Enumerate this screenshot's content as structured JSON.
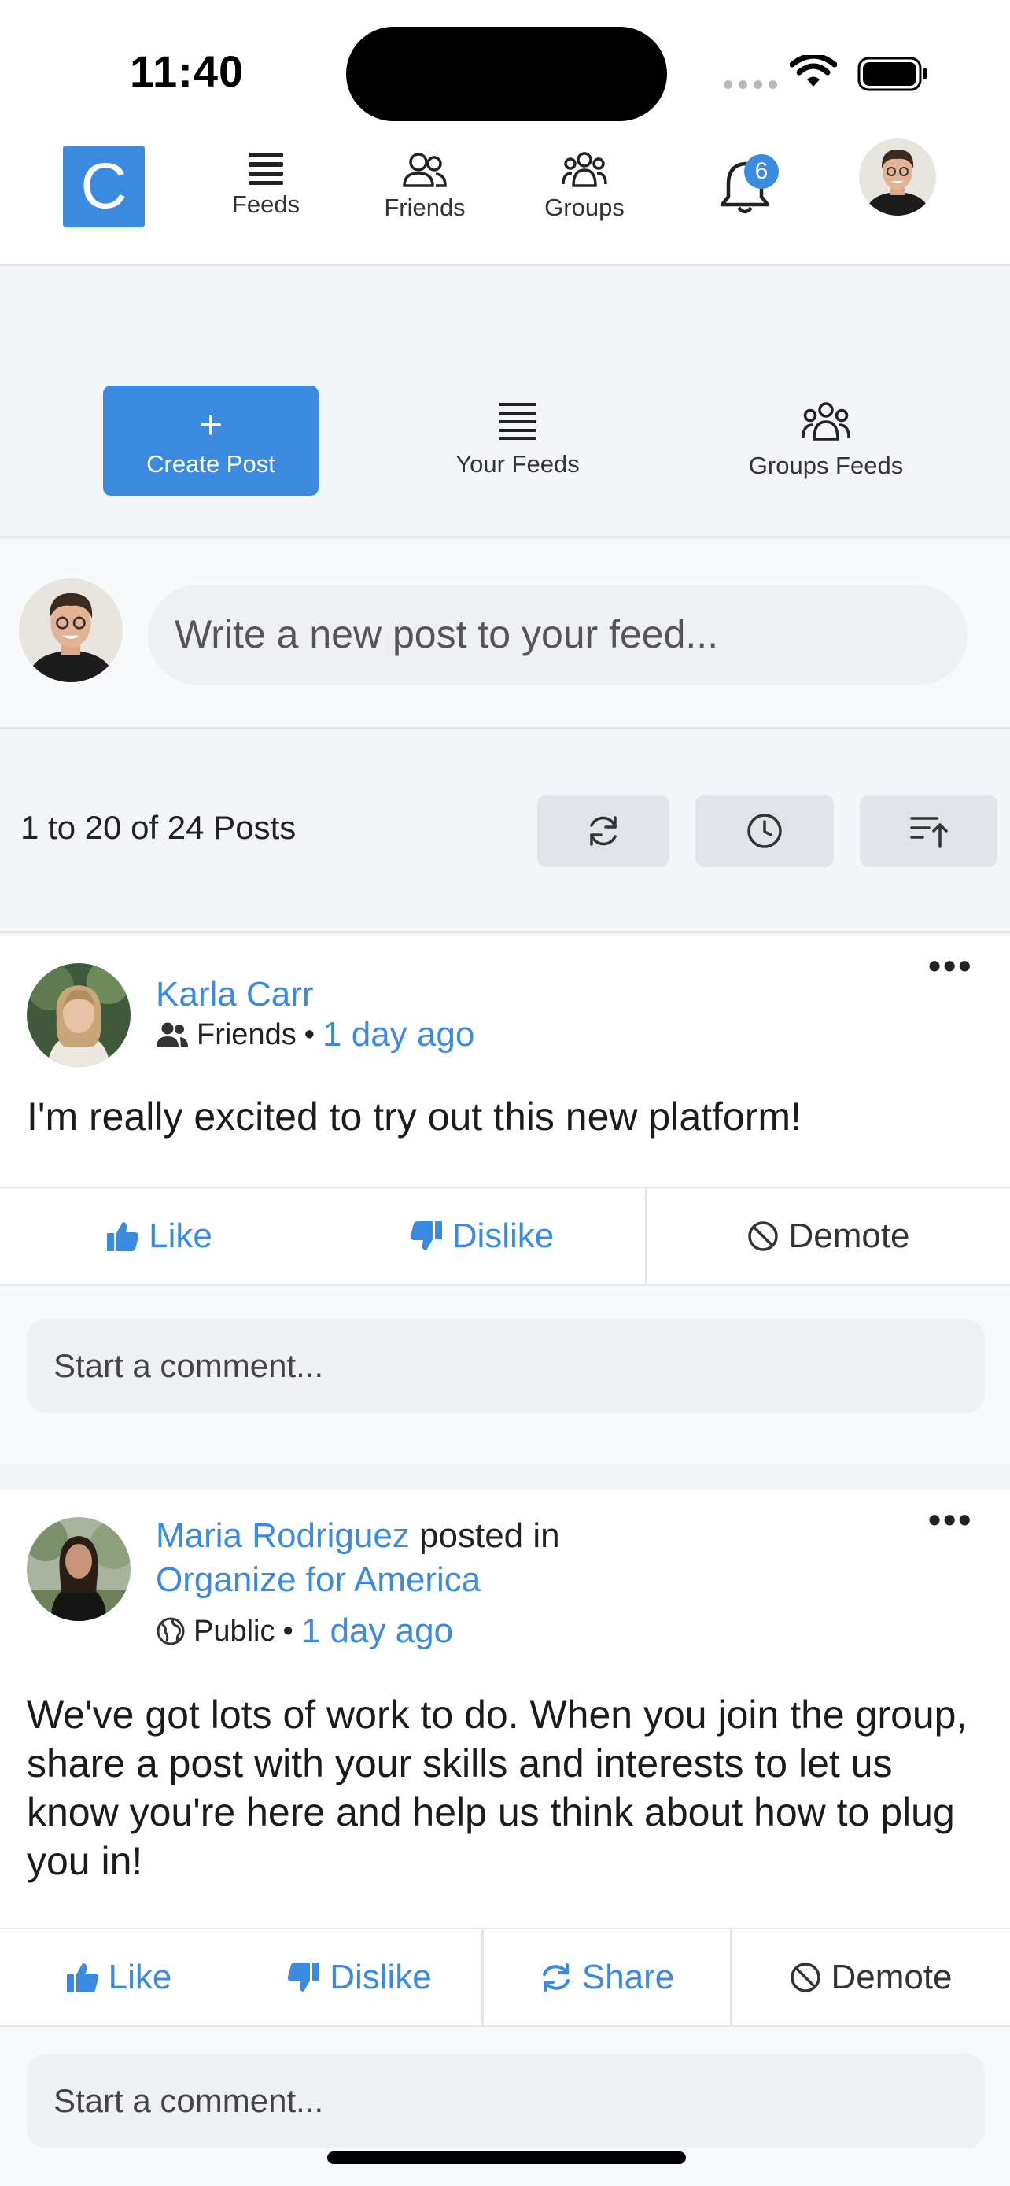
{
  "status_bar": {
    "time": "11:40"
  },
  "nav": {
    "logo_letter": "C",
    "items": [
      {
        "label": "Feeds",
        "icon": "feeds-icon"
      },
      {
        "label": "Friends",
        "icon": "friends-icon"
      },
      {
        "label": "Groups",
        "icon": "groups-icon"
      }
    ],
    "notification_count": "6"
  },
  "actions": {
    "create_post": "Create Post",
    "your_feeds": "Your Feeds",
    "groups_feeds": "Groups Feeds"
  },
  "composer": {
    "placeholder": "Write a new post to your feed..."
  },
  "pagination": {
    "summary": "1 to 20 of 24 Posts"
  },
  "posts": [
    {
      "author": "Karla Carr",
      "posted_in_text": "",
      "group": "",
      "audience": "Friends",
      "audience_icon": "friends-icon",
      "time_ago": "1 day ago",
      "body": "I'm really excited to try out this new platform!",
      "actions": {
        "like": "Like",
        "dislike": "Dislike",
        "demote": "Demote"
      },
      "comment_placeholder": "Start a comment..."
    },
    {
      "author": "Maria Rodriguez",
      "posted_in_text": "posted in",
      "group": "Organize for America",
      "audience": "Public",
      "audience_icon": "globe-icon",
      "time_ago": "1 day ago",
      "body": "We've got lots of work to do. When you join the group, share a post with your skills and interests to let us know you're here and help us think about how to plug you in!",
      "actions": {
        "like": "Like",
        "dislike": "Dislike",
        "share": "Share",
        "demote": "Demote"
      },
      "comment_placeholder": "Start a comment..."
    }
  ],
  "colors": {
    "accent": "#3a8be0",
    "background": "#f4f5f8"
  }
}
